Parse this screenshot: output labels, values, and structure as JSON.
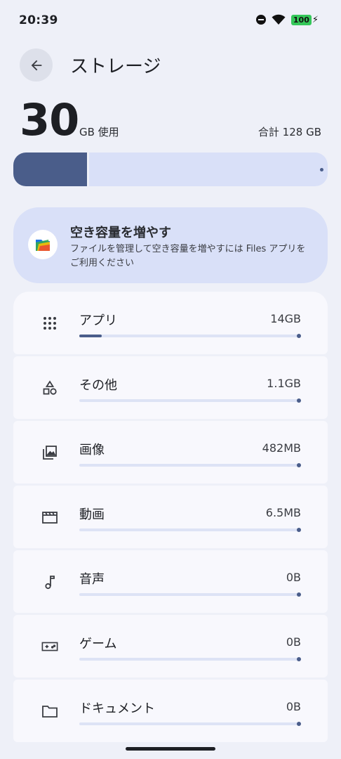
{
  "status_bar": {
    "time": "20:39",
    "battery": "100"
  },
  "header": {
    "title": "ストレージ"
  },
  "summary": {
    "used_value": "30",
    "used_label": "GB 使用",
    "total_label": "合計 128 GB",
    "used_fraction": 0.234
  },
  "free_up": {
    "title": "空き容量を増やす",
    "description": "ファイルを管理して空き容量を増やすには Files アプリをご利用ください"
  },
  "categories": [
    {
      "label": "アプリ",
      "size": "14GB",
      "fraction": 0.1,
      "icon": "apps-grid-icon"
    },
    {
      "label": "その他",
      "size": "1.1GB",
      "fraction": 0.0,
      "icon": "shapes-icon"
    },
    {
      "label": "画像",
      "size": "482MB",
      "fraction": 0.0,
      "icon": "photo-library-icon"
    },
    {
      "label": "動画",
      "size": "6.5MB",
      "fraction": 0.0,
      "icon": "movie-icon"
    },
    {
      "label": "音声",
      "size": "0B",
      "fraction": 0.0,
      "icon": "music-note-icon"
    },
    {
      "label": "ゲーム",
      "size": "0B",
      "fraction": 0.0,
      "icon": "gamepad-icon"
    },
    {
      "label": "ドキュメント",
      "size": "0B",
      "fraction": 0.0,
      "icon": "folder-icon"
    }
  ],
  "colors": {
    "accent": "#4a5d8a",
    "track": "#dde3f5",
    "card": "#d9e0f8",
    "background": "#eef0f8"
  }
}
